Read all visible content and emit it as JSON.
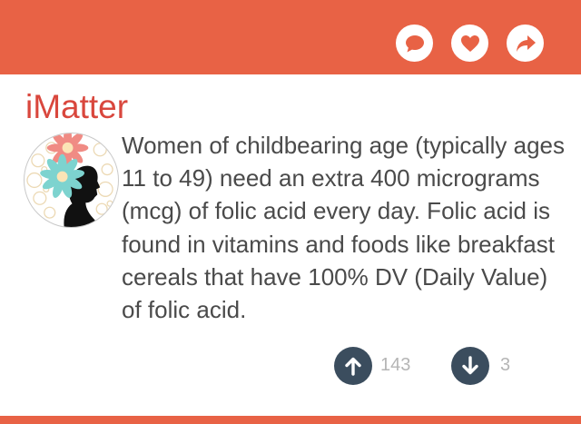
{
  "colors": {
    "accent": "#e86245",
    "title": "#d9473d",
    "vote_button": "#3b4d5e"
  },
  "header": {
    "actions": [
      {
        "icon": "comment-icon"
      },
      {
        "icon": "heart-icon"
      },
      {
        "icon": "share-arrow-icon"
      }
    ]
  },
  "post": {
    "app_name": "iMatter",
    "avatar_icon": "floral-woman-silhouette-avatar",
    "text": "Women of childbearing age (typically ages 11 to 49) need an extra 400 micrograms (mcg) of folic acid every day. Folic acid is found in vitamins and foods like breakfast cereals that have 100% DV (Daily Value) of folic acid.",
    "upvotes": "143",
    "downvotes": "3",
    "upvote_icon": "arrow-up-icon",
    "downvote_icon": "arrow-down-icon"
  }
}
